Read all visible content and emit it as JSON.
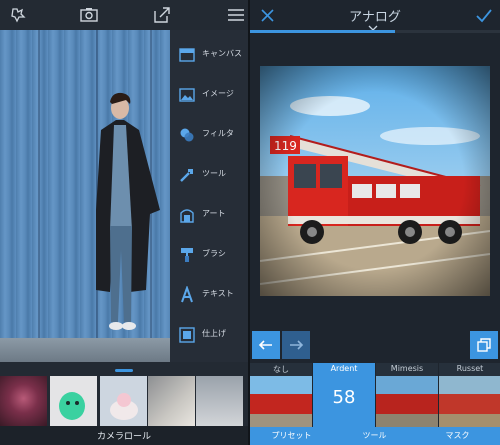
{
  "left_screen": {
    "tools": [
      {
        "label": "キャンバス",
        "icon": "canvas-icon"
      },
      {
        "label": "イメージ",
        "icon": "image-icon"
      },
      {
        "label": "フィルタ",
        "icon": "filter-icon"
      },
      {
        "label": "ツール",
        "icon": "tool-icon"
      },
      {
        "label": "アート",
        "icon": "art-icon"
      },
      {
        "label": "ブラシ",
        "icon": "brush-icon"
      },
      {
        "label": "テキスト",
        "icon": "text-icon"
      },
      {
        "label": "仕上げ",
        "icon": "finish-icon"
      }
    ],
    "camera_roll_label": "カメラロール"
  },
  "right_screen": {
    "title": "アナログ",
    "progress": 0.58,
    "presets": [
      {
        "name": "なし",
        "selected": false
      },
      {
        "name": "Ardent",
        "selected": true,
        "value": "58"
      },
      {
        "name": "Mimesis",
        "selected": false
      },
      {
        "name": "Russet",
        "selected": false
      }
    ],
    "tabs": [
      "プリセット",
      "ツール",
      "マスク"
    ]
  },
  "colors": {
    "accent": "#3c95e0",
    "panel": "#262d37",
    "background": "#1e252e"
  }
}
